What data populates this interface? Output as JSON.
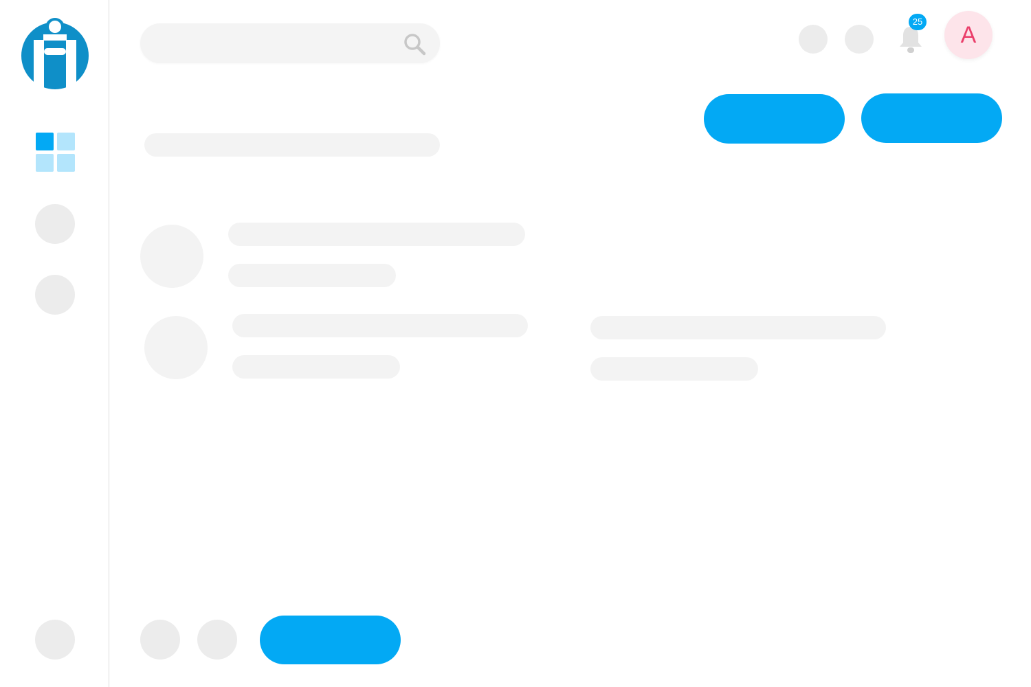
{
  "brand": {
    "logo_icon": "brand-logo-icon",
    "primary_color": "#03a9f4",
    "logo_color": "#0f8fc8"
  },
  "sidebar": {
    "items": [
      {
        "icon": "dashboard-grid-icon",
        "active": true
      },
      {
        "icon": "placeholder-circle"
      },
      {
        "icon": "placeholder-circle"
      }
    ],
    "bottom_item": {
      "icon": "placeholder-circle"
    }
  },
  "header": {
    "search": {
      "placeholder": "",
      "value": "",
      "icon": "search-icon"
    },
    "notifications": {
      "icon": "bell-icon",
      "count": "25"
    },
    "avatar": {
      "initial": "A",
      "background": "#fde4ea",
      "color": "#ea3e6a"
    }
  },
  "actions": {
    "primary_button_1": {
      "label": ""
    },
    "primary_button_2": {
      "label": ""
    }
  },
  "footer": {
    "primary_button": {
      "label": ""
    }
  },
  "state": {
    "loading_skeleton": true
  }
}
